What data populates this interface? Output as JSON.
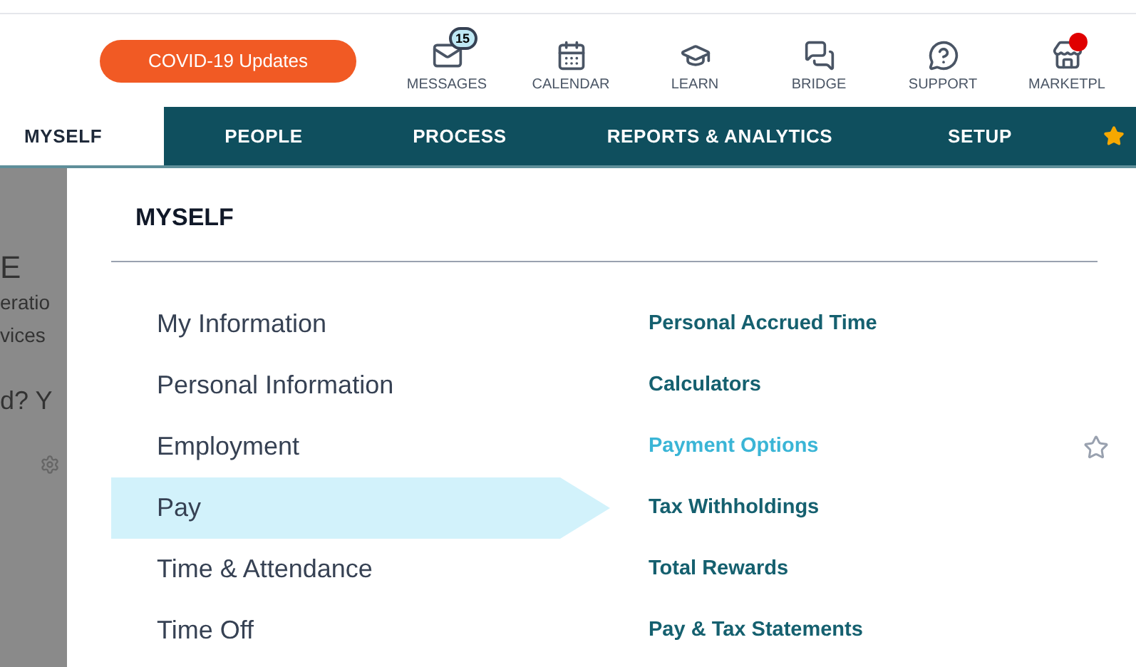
{
  "header": {
    "alert_button": "COVID-19 Updates",
    "shortcuts": [
      {
        "label": "MESSAGES",
        "badge": "15",
        "dot": false
      },
      {
        "label": "CALENDAR",
        "dot": false
      },
      {
        "label": "LEARN",
        "dot": false
      },
      {
        "label": "BRIDGE",
        "dot": false
      },
      {
        "label": "SUPPORT",
        "dot": false
      },
      {
        "label": "MARKETPL",
        "dot": true
      }
    ]
  },
  "nav": {
    "tabs": [
      {
        "label": "MYSELF",
        "selected": true
      },
      {
        "label": "PEOPLE",
        "selected": false
      },
      {
        "label": "PROCESS",
        "selected": false
      },
      {
        "label": "REPORTS & ANALYTICS",
        "selected": false
      },
      {
        "label": "SETUP",
        "selected": false
      }
    ]
  },
  "background_fragments": [
    "E",
    "eratio",
    "vices",
    "d? Y"
  ],
  "menu": {
    "title": "MYSELF",
    "categories": [
      {
        "label": "My Information",
        "selected": false
      },
      {
        "label": "Personal Information",
        "selected": false
      },
      {
        "label": "Employment",
        "selected": false
      },
      {
        "label": "Pay",
        "selected": true
      },
      {
        "label": "Time & Attendance",
        "selected": false
      },
      {
        "label": "Time Off",
        "selected": false
      }
    ],
    "links": [
      {
        "label": "Personal Accrued Time",
        "hovered": false
      },
      {
        "label": "Calculators",
        "hovered": false
      },
      {
        "label": "Payment Options",
        "hovered": true
      },
      {
        "label": "Tax Withholdings",
        "hovered": false
      },
      {
        "label": "Total Rewards",
        "hovered": false
      },
      {
        "label": "Pay & Tax Statements",
        "hovered": false
      }
    ]
  }
}
